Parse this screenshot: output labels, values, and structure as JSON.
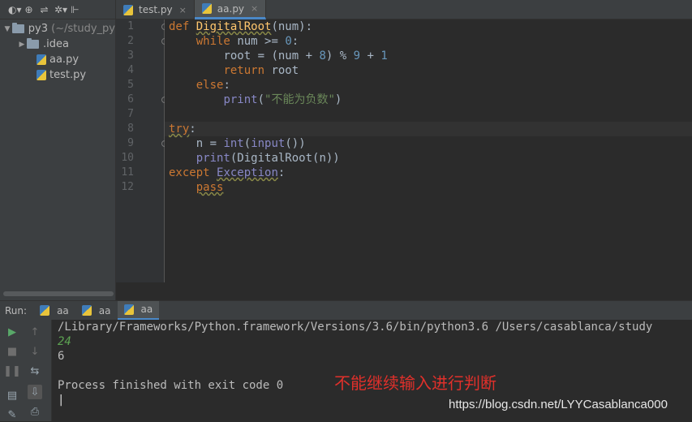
{
  "sidebar": {
    "toolbar": [
      "◐▾",
      "⊕",
      "⇌",
      "✲▾",
      "⊩"
    ],
    "items": [
      {
        "arrow": "▼",
        "name": "py3",
        "extra": "(~/study_py"
      },
      {
        "arrow": "▶",
        "name": ".idea"
      },
      {
        "name": "aa.py"
      },
      {
        "name": "test.py"
      }
    ]
  },
  "tabs": [
    {
      "label": "test.py",
      "close": "×"
    },
    {
      "label": "aa.py",
      "close": "×"
    }
  ],
  "editor": {
    "line_numbers": [
      "1",
      "2",
      "3",
      "4",
      "5",
      "6",
      "7",
      "8",
      "9",
      "10",
      "11",
      "12"
    ],
    "line1": [
      "def",
      "DigitalRoot",
      "(num):"
    ],
    "line2": [
      "while",
      "num >=",
      "0",
      ":"
    ],
    "line3": [
      "root = (num +",
      "8",
      ") %",
      "9",
      "+",
      "1"
    ],
    "line4": [
      "return",
      "root"
    ],
    "line5": [
      "else",
      ":"
    ],
    "line6": [
      "print",
      "(",
      "\"不能为负数\"",
      ")"
    ],
    "line8": [
      "try",
      ":"
    ],
    "line9": [
      "n =",
      "int",
      "(",
      "input",
      "())"
    ],
    "line10": [
      "print",
      "(DigitalRoot(n))"
    ],
    "line11": [
      "except",
      "Exception",
      ":"
    ],
    "line12": [
      "pass"
    ]
  },
  "run": {
    "label": "Run:",
    "tabs": [
      "aa",
      "aa",
      "aa"
    ]
  },
  "console": {
    "lines": [
      "/Library/Frameworks/Python.framework/Versions/3.6/bin/python3.6 /Users/casablanca/study",
      "24",
      "6",
      "",
      "Process finished with exit code 0",
      "|"
    ]
  },
  "annotation": "不能继续输入进行判断",
  "watermark": "https://blog.csdn.net/LYYCasablanca000",
  "colors": {
    "keyword": "#cc7832",
    "function": "#ffc66d",
    "number": "#6897bb",
    "builtin": "#8888c6",
    "string": "#6a8759",
    "input_echo": "#5da352",
    "annotation": "#e0302b"
  }
}
